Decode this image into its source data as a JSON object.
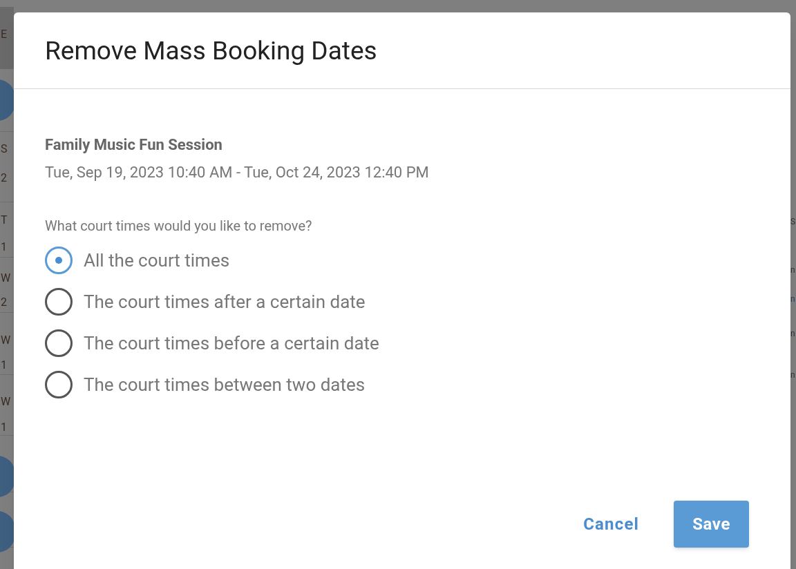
{
  "background": {
    "left_fragments": [
      "E",
      "S",
      "2",
      "T",
      "1",
      "W",
      "2",
      "W",
      "1",
      "W",
      "1"
    ],
    "right_fragments": [
      "S",
      "n",
      "n",
      "n",
      "n"
    ]
  },
  "dialog": {
    "title": "Remove Mass Booking Dates",
    "event_name": "Family Music Fun Session",
    "event_dates": "Tue, Sep 19, 2023 10:40 AM - Tue, Oct 24, 2023 12:40 PM",
    "question": "What court times would you like to remove?",
    "options": [
      {
        "label": "All the court times",
        "selected": true
      },
      {
        "label": "The court times after a certain date",
        "selected": false
      },
      {
        "label": "The court times before a certain date",
        "selected": false
      },
      {
        "label": "The court times between two dates",
        "selected": false
      }
    ],
    "buttons": [
      {
        "label": "Cancel",
        "kind": "text"
      },
      {
        "label": "Save",
        "kind": "primary"
      }
    ]
  }
}
